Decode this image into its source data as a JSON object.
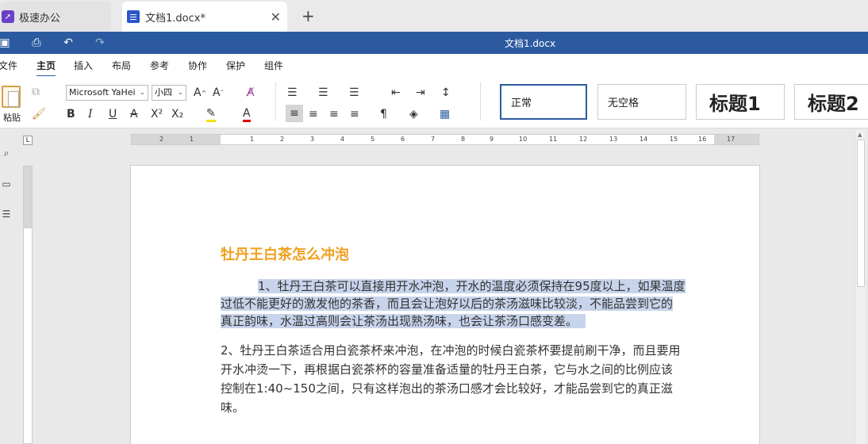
{
  "tabs": [
    {
      "label": "极速办公",
      "icon": "rocket-icon"
    },
    {
      "label": "文档1.docx*",
      "icon": "document-icon"
    }
  ],
  "titlebar": {
    "title": "文档1.docx"
  },
  "menu": [
    "文件",
    "主页",
    "插入",
    "布局",
    "参考",
    "协作",
    "保护",
    "组件"
  ],
  "ribbon": {
    "paste_label": "粘贴",
    "font_name": "Microsoft YaHei",
    "font_size": "小四",
    "styles": [
      "正常",
      "无空格",
      "标题1",
      "标题2"
    ]
  },
  "ruler": {
    "ticks": [
      "2",
      "1",
      "1",
      "2",
      "3",
      "4",
      "5",
      "6",
      "7",
      "8",
      "9",
      "10",
      "11",
      "12",
      "13",
      "14",
      "15",
      "16",
      "17"
    ],
    "corner": "L"
  },
  "document": {
    "heading": "牡丹王白茶怎么冲泡",
    "p1_line1": "1、牡丹王白茶可以直接用开水冲泡，开水的温度必须保持在95度以上，如果温度",
    "p1_line2": "过低不能更好的激发他的茶香，而且会让泡好以后的茶汤滋味比较淡，不能品尝到它的",
    "p1_line3": "真正韵味，水温过高则会让茶汤出现熟汤味，也会让茶汤口感变差。",
    "p2_line1": "2、牡丹王白茶适合用白瓷茶杯来冲泡，在冲泡的时候白瓷茶杯要提前刷干净，而且要用",
    "p2_line2": "开水冲烫一下，再根据白瓷茶杯的容量准备适量的牡丹王白茶，它与水之间的比例应该",
    "p2_line3": "控制在1:40~150之间，只有这样泡出的茶汤口感才会比较好，才能品尝到它的真正滋",
    "p2_line4": "味。"
  },
  "colors": {
    "accent": "#2c5aa0",
    "heading": "#f0a020",
    "selection": "#c8d4ec"
  }
}
